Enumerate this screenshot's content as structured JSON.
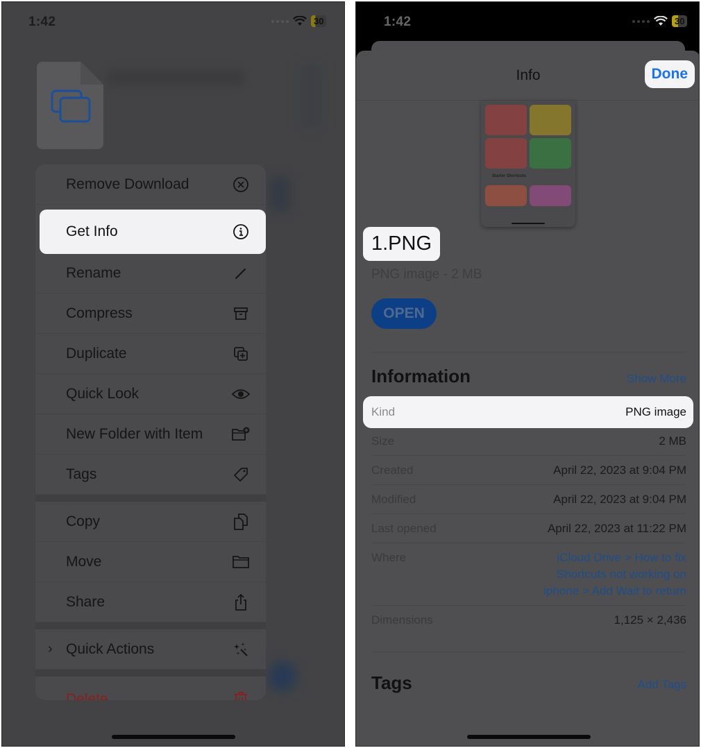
{
  "left_phone": {
    "status": {
      "time": "1:42",
      "battery": "30",
      "wifi_icon": "wifi-icon"
    },
    "file_icon": "stacked-windows-icon",
    "menu": {
      "items": [
        {
          "label": "Remove Download",
          "icon": "xmark-circle-icon"
        },
        {
          "label": "Get Info",
          "icon": "info-circle-icon",
          "highlighted": true
        },
        {
          "label": "Rename",
          "icon": "pencil-icon"
        },
        {
          "label": "Compress",
          "icon": "archive-box-icon"
        },
        {
          "label": "Duplicate",
          "icon": "duplicate-plus-icon"
        },
        {
          "label": "Quick Look",
          "icon": "eye-icon"
        },
        {
          "label": "New Folder with Item",
          "icon": "folder-badge-plus-icon"
        },
        {
          "label": "Tags",
          "icon": "tag-icon"
        },
        {
          "label": "Copy",
          "icon": "doc-on-doc-icon"
        },
        {
          "label": "Move",
          "icon": "folder-icon"
        },
        {
          "label": "Share",
          "icon": "share-icon"
        },
        {
          "label": "Quick Actions",
          "icon": "magic-wand-icon",
          "has_submenu": true
        },
        {
          "label": "Delete",
          "icon": "trash-icon",
          "destructive": true
        }
      ]
    }
  },
  "right_phone": {
    "status": {
      "time": "1:42",
      "battery": "30",
      "wifi_icon": "wifi-icon"
    },
    "header": {
      "title": "Info",
      "done_label": "Done"
    },
    "preview": {
      "section_label": "Starter Shortcuts",
      "tile_colors": [
        "#b23a3a",
        "#b59a12",
        "#b23a3a",
        "#2f8f3a",
        "#c2543a",
        "#b04a9a"
      ]
    },
    "file": {
      "name": "1.PNG",
      "subtitle": "PNG image - 2 MB",
      "open_label": "OPEN"
    },
    "information": {
      "title": "Information",
      "show_more_label": "Show More",
      "rows": [
        {
          "key": "Kind",
          "value": "PNG image"
        },
        {
          "key": "Size",
          "value": "2 MB"
        },
        {
          "key": "Created",
          "value": "April 22, 2023 at 9:04 PM"
        },
        {
          "key": "Modified",
          "value": "April 22, 2023 at 9:04 PM"
        },
        {
          "key": "Last opened",
          "value": "April 22, 2023 at 11:22 PM"
        },
        {
          "key": "Where",
          "value_lines": [
            "iCloud Drive > How to fix",
            "Shortcuts not working on",
            "iphone > Add Wait to return"
          ]
        },
        {
          "key": "Dimensions",
          "value": "1,125 × 2,436"
        }
      ]
    },
    "tags": {
      "title": "Tags",
      "add_label": "Add Tags"
    }
  },
  "colors": {
    "accent_blue": "#1a73e8",
    "dimmed_link": "#1f4d8a",
    "destructive": "#8a1e1e",
    "highlight": "#f4f4f6"
  }
}
